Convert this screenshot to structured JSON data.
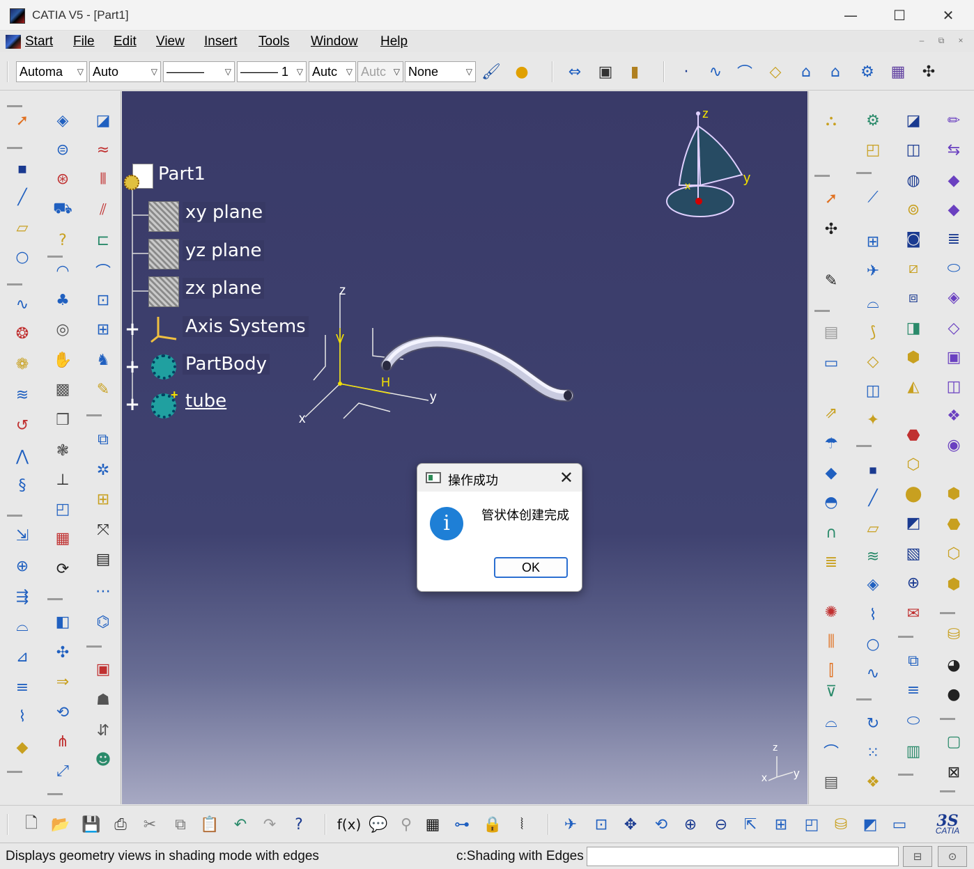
{
  "window": {
    "title": "CATIA V5 - [Part1]",
    "minimize_glyph": "—",
    "maximize_glyph": "☐",
    "close_glyph": "✕"
  },
  "menu": {
    "items": [
      "Start",
      "File",
      "Edit",
      "View",
      "Insert",
      "Tools",
      "Window",
      "Help"
    ],
    "mdi_buttons": [
      "–",
      "⧉",
      "×"
    ]
  },
  "toolbar": {
    "combos": [
      {
        "value": "Automa",
        "disabled": false
      },
      {
        "value": "Auto",
        "disabled": false
      },
      {
        "value": "———",
        "disabled": false
      },
      {
        "value": "——— 1",
        "disabled": false
      },
      {
        "value": "Autc",
        "disabled": false
      },
      {
        "value": "Autc",
        "disabled": true
      },
      {
        "value": "None",
        "disabled": false
      }
    ]
  },
  "tree": {
    "root": "Part1",
    "nodes": [
      {
        "label": "xy plane",
        "icon": "plane-icon"
      },
      {
        "label": "yz plane",
        "icon": "plane-icon"
      },
      {
        "label": "zx plane",
        "icon": "plane-icon"
      },
      {
        "label": "Axis Systems",
        "icon": "axis-system-icon",
        "expandable": true
      },
      {
        "label": "PartBody",
        "icon": "partbody-gear-icon",
        "expandable": true
      },
      {
        "label": "tube",
        "icon": "body-gear-icon",
        "expandable": true,
        "underlined": true
      }
    ]
  },
  "axis_labels": {
    "compass_z": "z",
    "compass_y": "y",
    "compass_x": "x",
    "local_z": "z",
    "local_v": "V",
    "local_h": "H",
    "local_y": "y",
    "local_x": "x",
    "corner_z": "z",
    "corner_y": "y",
    "corner_x": "x"
  },
  "dialog": {
    "title": "操作成功",
    "message": "管状体创建完成",
    "ok_label": "OK",
    "close_glyph": "✕",
    "info_glyph": "i"
  },
  "statusbar": {
    "message": "Displays geometry views in shading mode with edges",
    "mode": "c:Shading with Edges",
    "brand": "CATIA"
  },
  "colors": {
    "viewport_top": "#393a68",
    "viewport_bottom": "#a7a9c3",
    "dialog_ok_border": "#2b6fd1",
    "info_blue": "#1e7fd6"
  }
}
